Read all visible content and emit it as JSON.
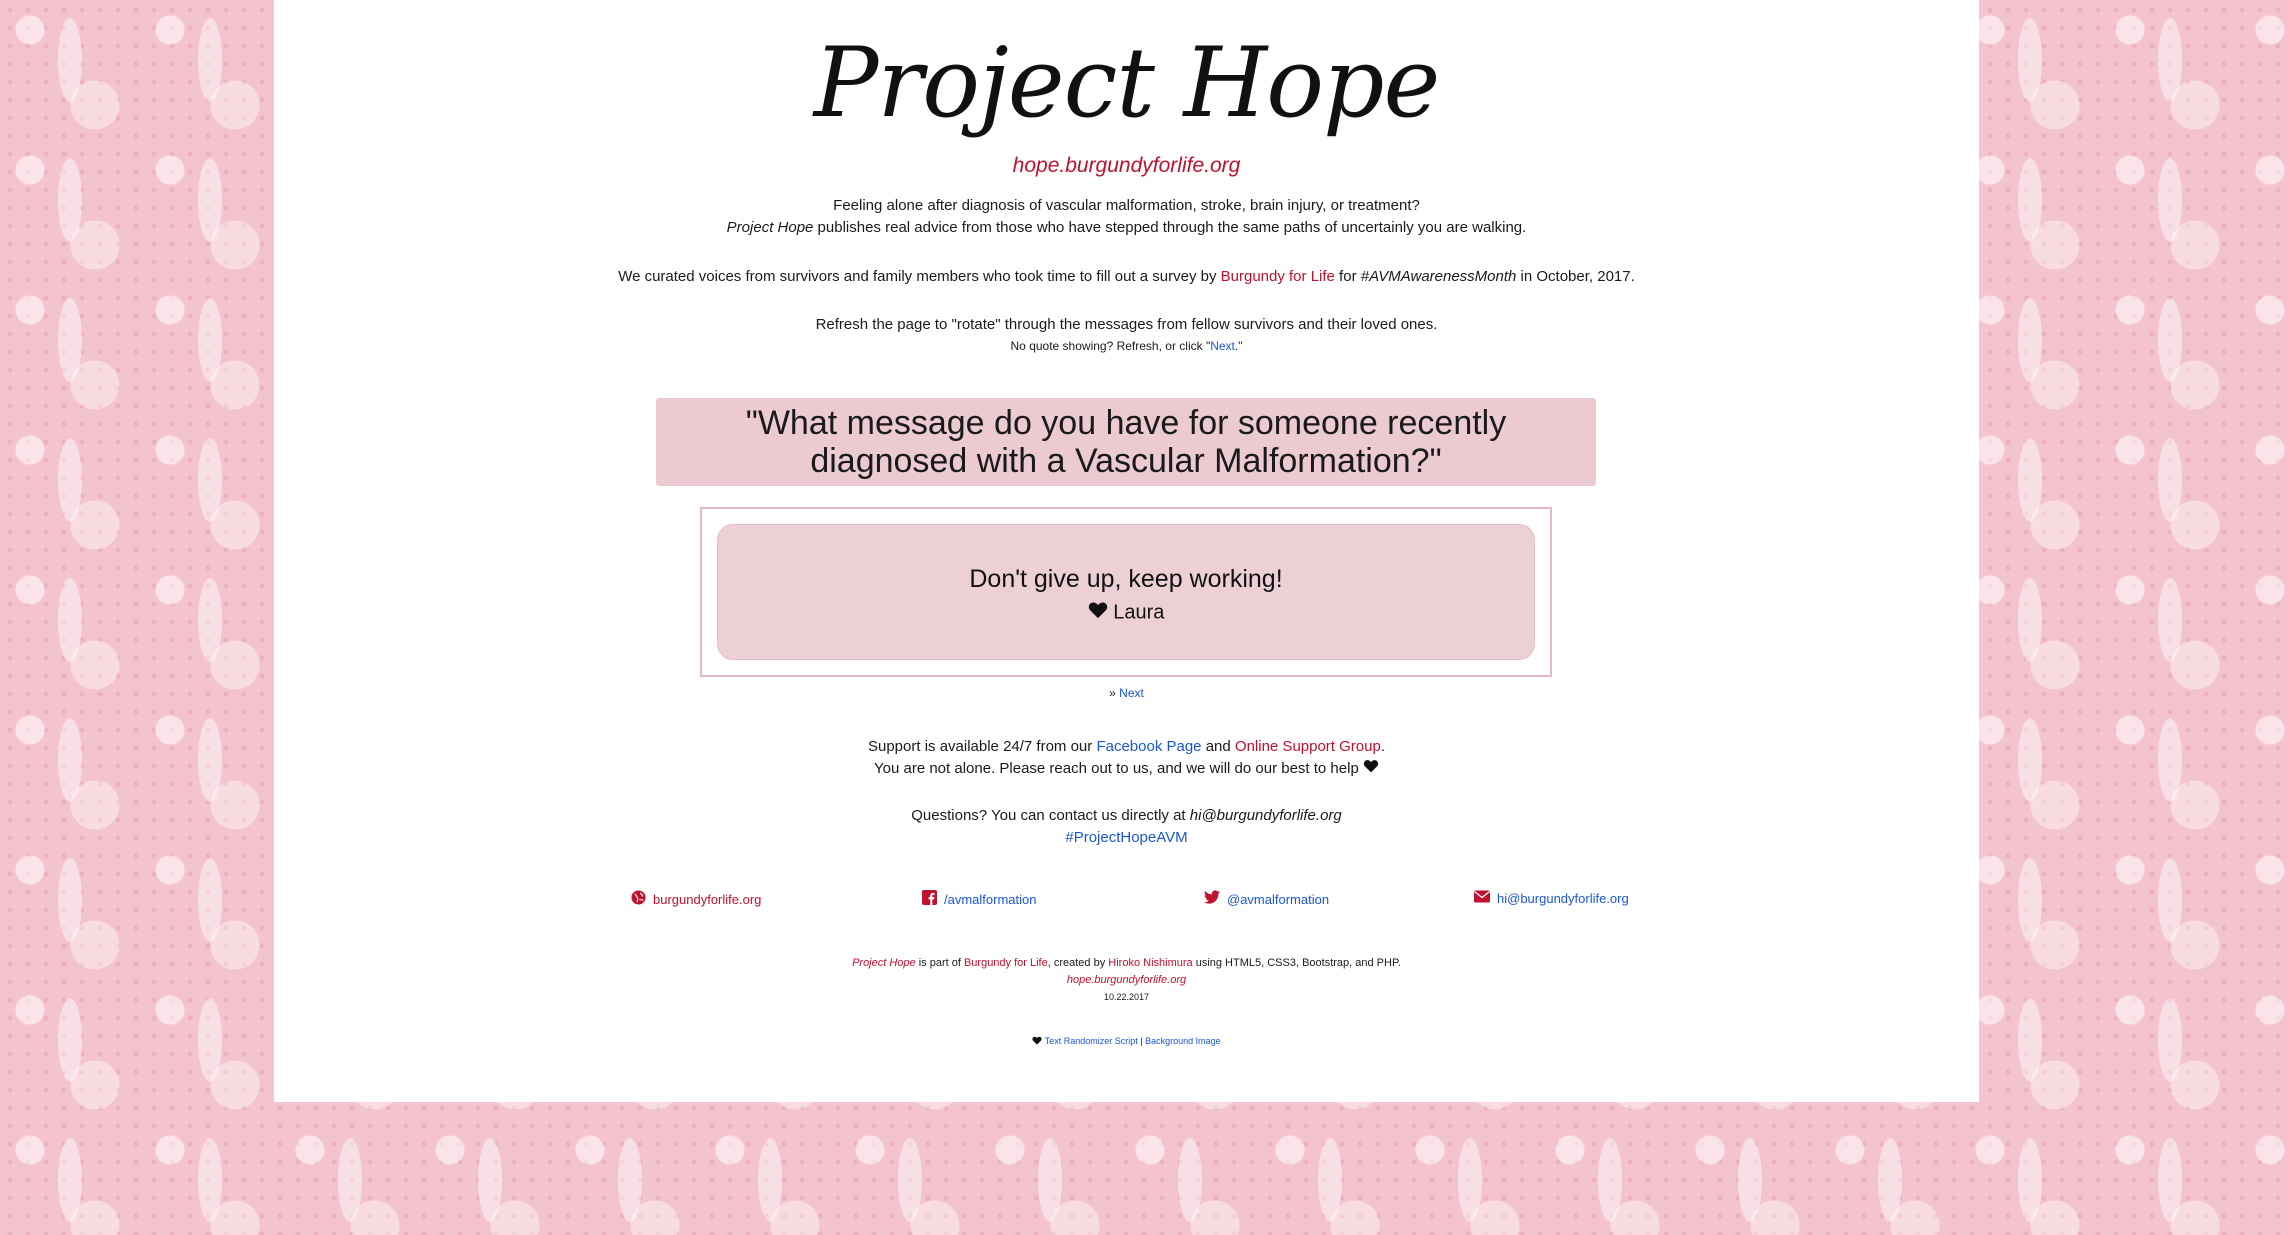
{
  "header": {
    "title": "Project Hope",
    "subdomain": "hope.burgundyforlife.org"
  },
  "intro": {
    "line1": "Feeling alone after diagnosis of vascular malformation, stroke, brain injury, or treatment?",
    "line2_em": "Project Hope",
    "line2_rest": " publishes real advice from those who have stepped through the same paths of uncertainly you are walking.",
    "line3_pre": "We curated voices from survivors and family members who took time to fill out a survey by ",
    "line3_link": "Burgundy for Life",
    "line3_mid": " for ",
    "line3_tag": "#AVMAwarenessMonth",
    "line3_post": " in October, 2017.",
    "line4": "Refresh the page to \"rotate\" through the messages from fellow survivors and their loved ones.",
    "line5_pre": "No quote showing? Refresh, or click \"",
    "line5_link": "Next",
    "line5_post": ".\""
  },
  "question": {
    "line1": "\"What message do you have for someone recently",
    "line2": "diagnosed with a Vascular Malformation?\""
  },
  "quote": {
    "text": "Don't give up, keep working!",
    "author": "Laura"
  },
  "next": {
    "arrow": "»",
    "label": "Next"
  },
  "support": {
    "pre": "Support is available 24/7 from our ",
    "facebook": "Facebook Page",
    "and": " and ",
    "group": "Online Support Group",
    "end": ".",
    "line2": "You are not alone. Please reach out to us, and we will do our best to help"
  },
  "contact": {
    "pre": "Questions? You can contact us directly at ",
    "email": "hi@burgundyforlife.org",
    "hashtag": "#ProjectHopeAVM"
  },
  "links": [
    {
      "icon": "globe-icon",
      "label": "burgundyforlife.org"
    },
    {
      "icon": "facebook-icon",
      "label": "/avmalformation"
    },
    {
      "icon": "twitter-icon",
      "label": "@avmalformation"
    },
    {
      "icon": "envelope-icon",
      "label": "hi@burgundyforlife.org"
    }
  ],
  "footer": {
    "em": "Project Hope",
    "part": " is part of ",
    "bfl": "Burgundy for Life",
    "created": ", created by ",
    "author": "Hiroko Nishimura",
    "tech": " using HTML5, CSS3, Bootstrap, and PHP.",
    "domain": "hope.burgundyforlife.org",
    "date": "10.22.2017"
  },
  "credits": {
    "script": "Text Randomizer Script",
    "sep": " | ",
    "image": "Background Image"
  },
  "colors": {
    "accent": "#c0102f",
    "link": "#1a56d6",
    "card": "#ecd0d6",
    "background": "#f3c4cf"
  }
}
